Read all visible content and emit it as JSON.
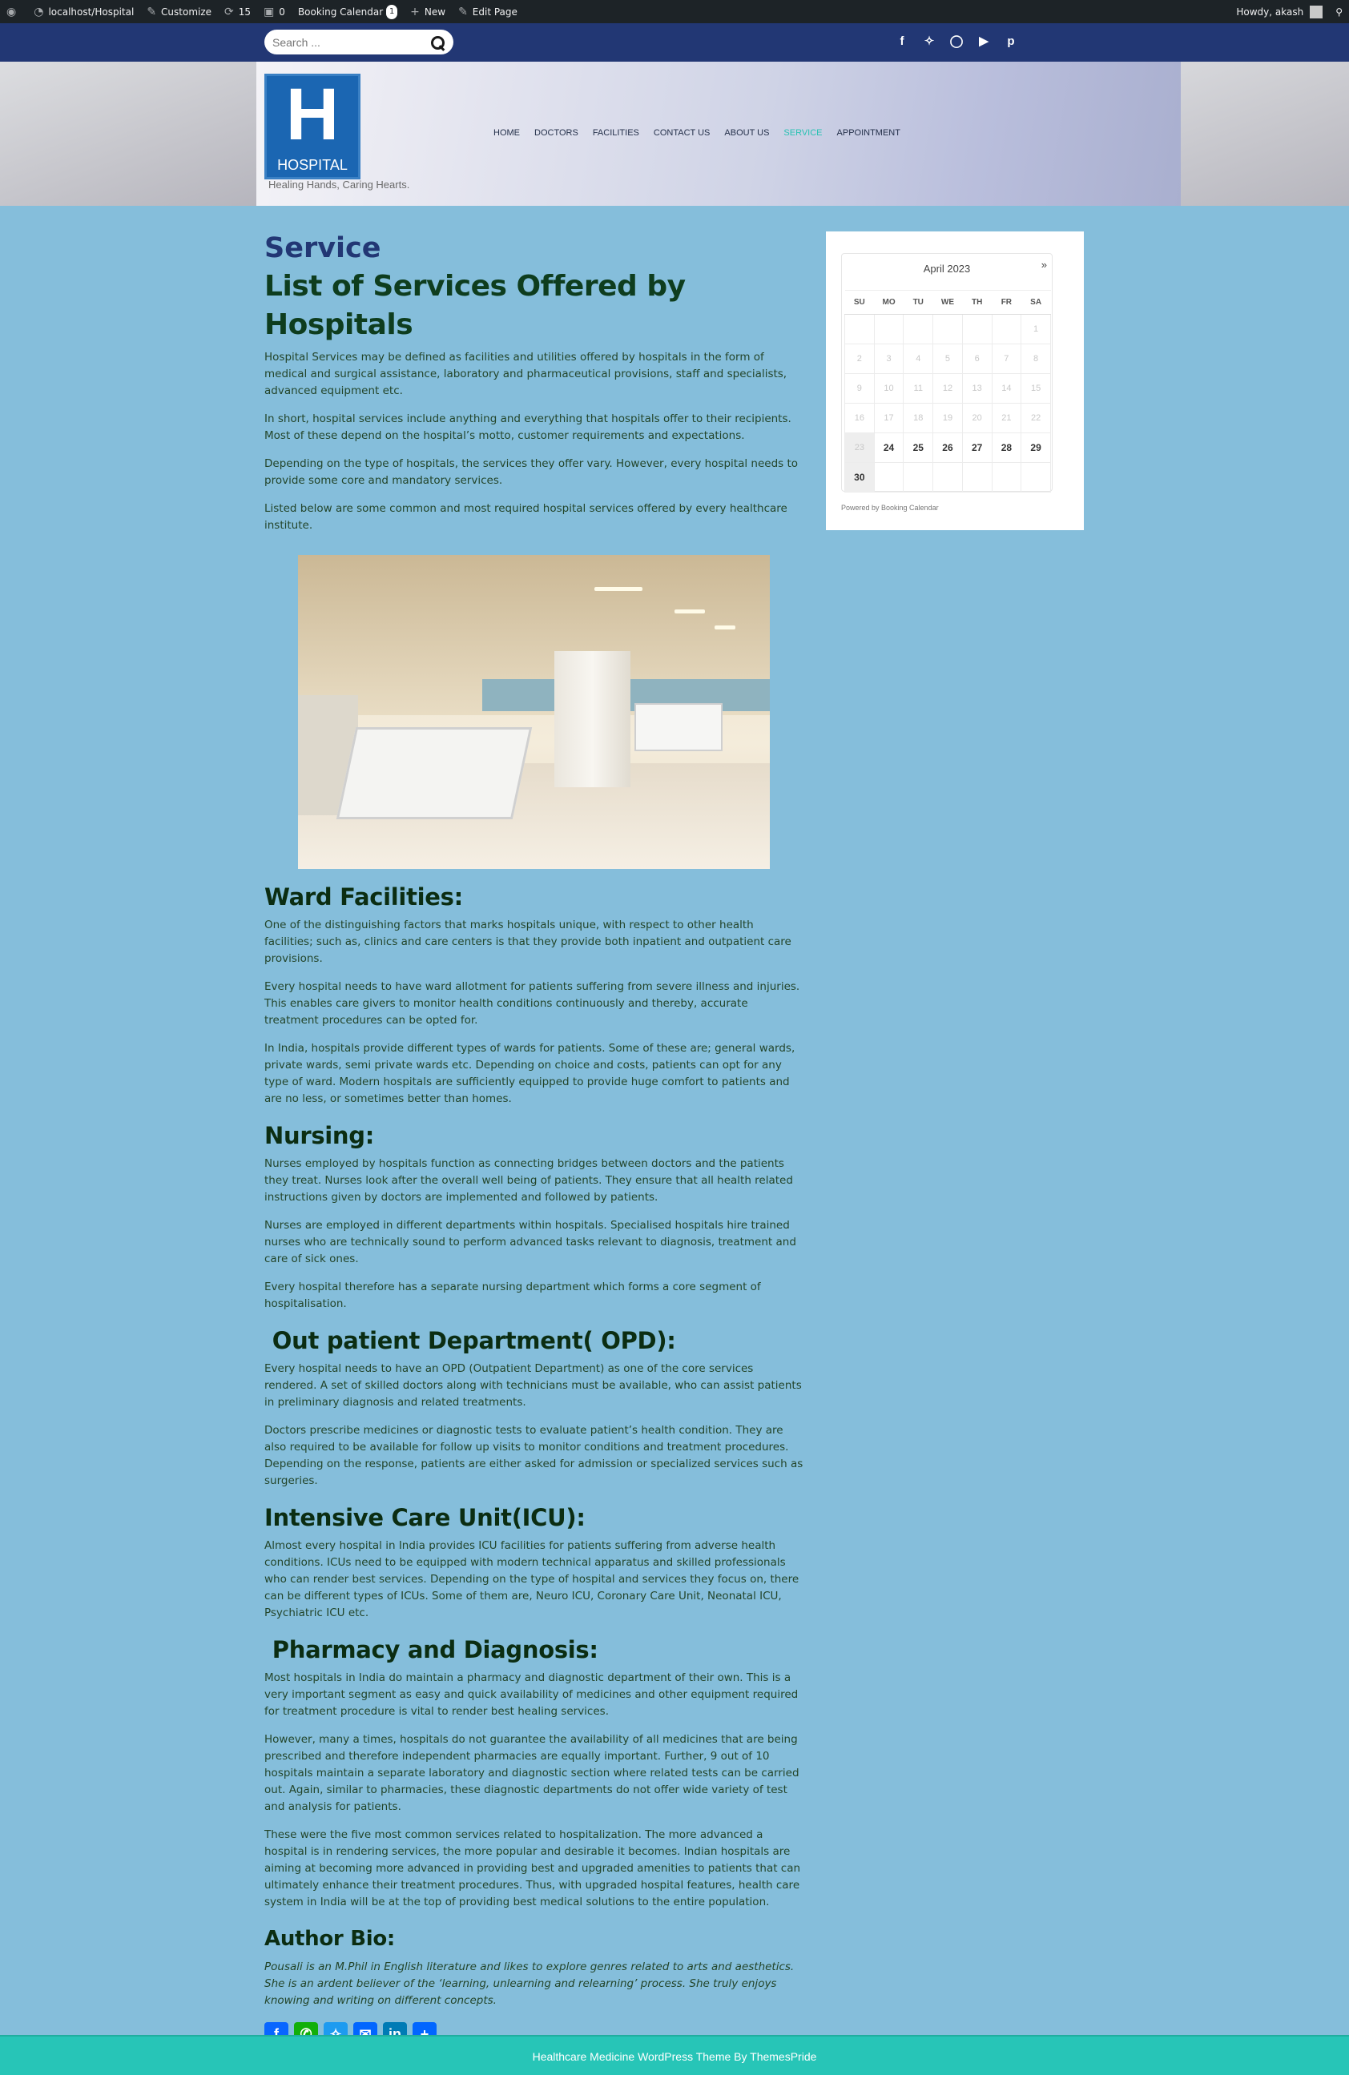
{
  "admin_bar": {
    "site": "localhost/Hospital",
    "customize": "Customize",
    "updates_count": "15",
    "comments_count": "0",
    "booking_calendar": "Booking Calendar",
    "booking_badge": "1",
    "new": "New",
    "edit_page": "Edit Page",
    "howdy": "Howdy, akash"
  },
  "search": {
    "placeholder": "Search ..."
  },
  "social": [
    "facebook",
    "twitter",
    "instagram",
    "youtube",
    "pinterest"
  ],
  "brand": {
    "logo_letter": "H",
    "logo_text": "HOSPITAL",
    "tagline": "Healing Hands, Caring Hearts."
  },
  "nav": [
    "HOME",
    "DOCTORS",
    "FACILITIES",
    "CONTACT US",
    "ABOUT US",
    "SERVICE",
    "APPOINTMENT"
  ],
  "nav_active": "SERVICE",
  "content": {
    "page_title": "Service",
    "main_heading": "List of Services Offered by Hospitals",
    "intro": [
      "Hospital Services may be defined as facilities and utilities offered by hospitals in the form of medical and surgical assistance, laboratory and pharmaceutical provisions, staff and specialists, advanced equipment etc.",
      "In short, hospital services include anything and everything that hospitals offer to their recipients. Most of these depend on the hospital’s motto, customer requirements and expectations.",
      "Depending on the type of hospitals, the services they offer vary. However, every hospital needs to provide some core and mandatory services.",
      "Listed below are some common and most required hospital services offered by every healthcare institute."
    ],
    "ward": {
      "heading": "Ward Facilities:",
      "paragraphs": [
        " One of the distinguishing factors that marks hospitals unique, with respect to other health facilities; such as, clinics and care centers is that they provide both inpatient and outpatient care provisions.",
        "Every hospital needs to have ward allotment for patients suffering from severe illness and injuries. This enables care givers to monitor health conditions continuously and thereby, accurate treatment procedures can be opted for.",
        "In India, hospitals provide different types of wards for patients. Some of these are; general wards, private wards, semi private wards etc. Depending on choice and costs, patients can opt for any type of ward. Modern hospitals are sufficiently equipped to provide huge comfort to patients and are no less, or sometimes better than homes."
      ]
    },
    "nursing": {
      "heading": "Nursing:",
      "paragraphs": [
        "Nurses employed by hospitals function as connecting bridges between doctors and the patients they treat. Nurses look after the overall well being of patients. They ensure that all health related instructions given by doctors are implemented and followed by patients.",
        "Nurses are employed in different departments within hospitals. Specialised hospitals hire trained nurses who are technically sound to perform advanced tasks relevant to diagnosis, treatment and care of sick ones.",
        "Every hospital therefore has a separate nursing department which forms a core segment of hospitalisation."
      ]
    },
    "opd": {
      "heading": " Out patient Department( OPD):",
      "paragraphs": [
        "Every hospital needs to have an OPD (Outpatient Department) as one of the core services rendered. A set of skilled doctors along with technicians must be available, who can assist patients in preliminary diagnosis and related treatments.",
        "Doctors prescribe medicines or diagnostic tests to evaluate patient’s health condition. They are also required to be available for follow up visits to monitor conditions and treatment procedures. Depending on the response, patients are either asked for admission or specialized services such as surgeries."
      ]
    },
    "icu": {
      "heading": "Intensive Care Unit(ICU):",
      "paragraphs": [
        " Almost every hospital in India provides ICU facilities for patients suffering from adverse health conditions. ICUs need to be equipped with modern technical apparatus and skilled professionals who can render best services. Depending on the type of hospital and services they focus on, there can be different types of ICUs. Some of them are, Neuro ICU, Coronary Care Unit, Neonatal ICU, Psychiatric ICU etc."
      ]
    },
    "pharmacy": {
      "heading": " Pharmacy and Diagnosis:",
      "paragraphs": [
        " Most hospitals in India do maintain a pharmacy and diagnostic department of their own. This is a very important segment as easy and quick availability of medicines and other equipment required for treatment procedure is vital to render best healing services.",
        " However, many a times, hospitals do not guarantee the availability of all medicines that are being prescribed and therefore independent pharmacies are equally important. Further, 9 out of 10 hospitals maintain a separate laboratory and diagnostic section where related tests can be carried out. Again, similar to pharmacies, these diagnostic departments do not offer wide variety of test and analysis for patients.",
        "These were the five most common services related to hospitalization. The more advanced a hospital is in rendering services, the more popular and desirable it becomes. Indian hospitals are aiming at becoming more advanced in providing best and upgraded amenities to patients that can ultimately enhance their treatment procedures. Thus, with upgraded hospital features, health care system in India will be at the top of providing best medical solutions to the entire population."
      ]
    },
    "author": {
      "heading": "Author Bio:",
      "bio": "Pousali is an M.Phil in English literature and likes to explore genres related to arts and aesthetics. She is an ardent believer of the ‘learning, unlearning and relearning’ process. She truly enjoys knowing and writing on different concepts."
    },
    "share_buttons": [
      "facebook",
      "whatsapp",
      "twitter",
      "email",
      "linkedin",
      "share"
    ]
  },
  "calendar": {
    "title": "April 2023",
    "next": "»",
    "weekdays": [
      "SU",
      "MO",
      "TU",
      "WE",
      "TH",
      "FR",
      "SA"
    ],
    "weeks": [
      [
        "",
        "",
        "",
        "",
        "",
        "",
        "1"
      ],
      [
        "2",
        "3",
        "4",
        "5",
        "6",
        "7",
        "8"
      ],
      [
        "9",
        "10",
        "11",
        "12",
        "13",
        "14",
        "15"
      ],
      [
        "16",
        "17",
        "18",
        "19",
        "20",
        "21",
        "22"
      ],
      [
        "23",
        "24",
        "25",
        "26",
        "27",
        "28",
        "29"
      ],
      [
        "30",
        "",
        "",
        "",
        "",
        "",
        ""
      ]
    ],
    "first_available_day": 24,
    "powered_by": "Powered by Booking Calendar"
  },
  "footer": {
    "text": "Healthcare Medicine WordPress Theme By ThemesPride"
  },
  "colors": {
    "accent": "#27c5b7",
    "navy": "#223774",
    "page_bg": "#85bedb",
    "heading_green": "#0b2d12"
  }
}
